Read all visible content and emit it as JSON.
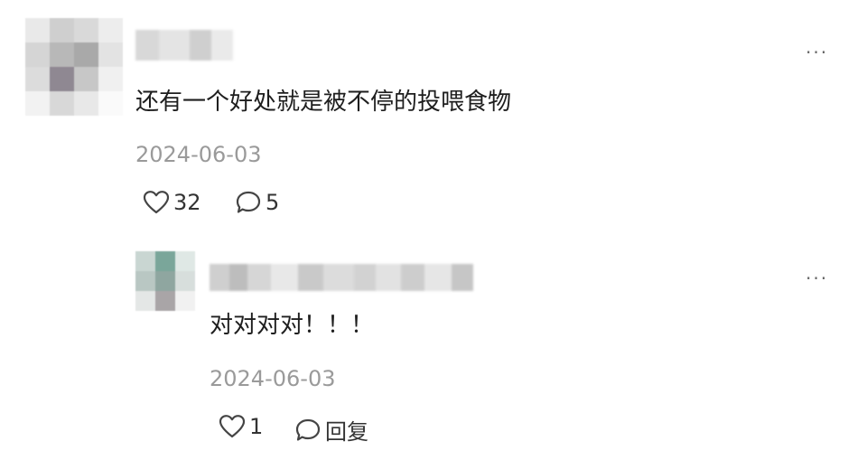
{
  "comment": {
    "text": "还有一个好处就是被不停的投喂食物",
    "date": "2024-06-03",
    "like_count": "32",
    "reply_count": "5",
    "more_label": "···"
  },
  "reply": {
    "text": "对对对对！！！",
    "date": "2024-06-03",
    "like_count": "1",
    "reply_label": "回复",
    "more_label": "···"
  },
  "colors": {
    "date": "#9a9a9a",
    "text": "#1e1e1e",
    "icon": "#444444"
  },
  "icons": {
    "like": "heart-icon",
    "comment": "comment-bubble-icon",
    "more": "more-dots-icon"
  }
}
